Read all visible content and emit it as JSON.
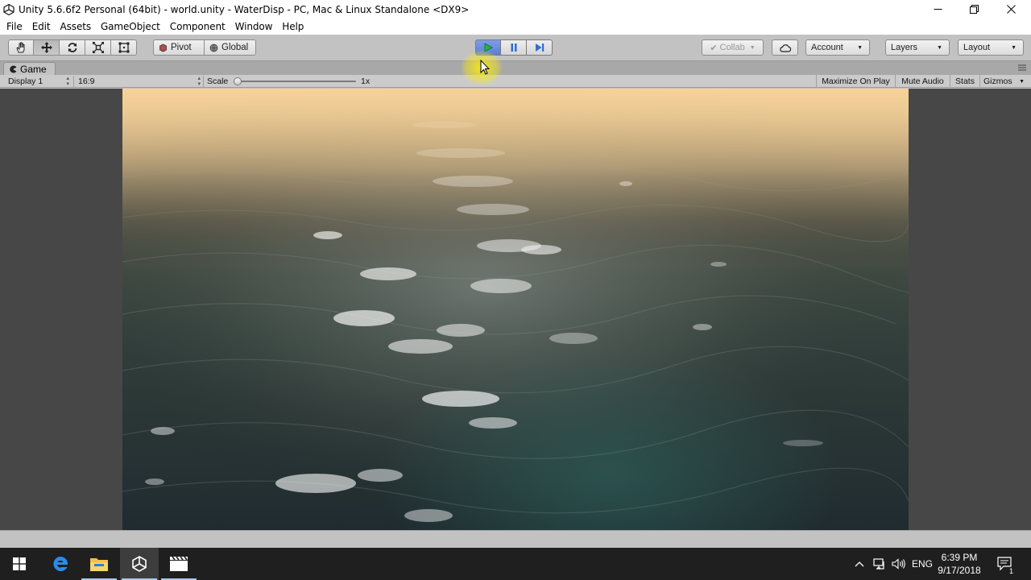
{
  "window": {
    "title": "Unity 5.6.6f2 Personal (64bit) - world.unity - WaterDisp - PC, Mac & Linux Standalone <DX9>"
  },
  "menu": [
    "File",
    "Edit",
    "Assets",
    "GameObject",
    "Component",
    "Window",
    "Help"
  ],
  "toolbar": {
    "tools": [
      "hand-icon",
      "move-icon",
      "rotate-icon",
      "scale-icon",
      "rect-icon"
    ],
    "active_tool": "move-icon",
    "pivot_label": "Pivot",
    "global_label": "Global",
    "collab_label": "Collab",
    "account_label": "Account",
    "layers_label": "Layers",
    "layout_label": "Layout",
    "play_active": true
  },
  "game_view": {
    "tab_label": "Game",
    "display_label": "Display 1",
    "aspect_label": "16:9",
    "scale_label": "Scale",
    "scale_value": "1x",
    "scale_fraction": 0.0,
    "maximize_label": "Maximize On Play",
    "mute_label": "Mute Audio",
    "stats_label": "Stats",
    "gizmos_label": "Gizmos"
  },
  "taskbar": {
    "language": "ENG",
    "time": "6:39 PM",
    "date": "9/17/2018",
    "notification_count": "1"
  },
  "colors": {
    "play_blue": "#5a7ed6",
    "sky_top": "#f7cf92",
    "ocean_deep": "#1f2b2f"
  }
}
